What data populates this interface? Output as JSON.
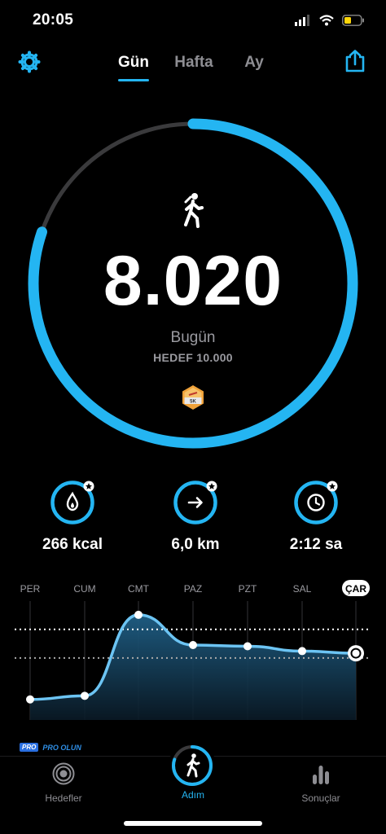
{
  "status": {
    "time": "20:05"
  },
  "tabs": [
    {
      "label": "Gün",
      "active": true
    },
    {
      "label": "Hafta",
      "active": false
    },
    {
      "label": "Ay",
      "active": false
    }
  ],
  "ring": {
    "steps": "8.020",
    "day_label": "Bugün",
    "goal_label": "HEDEF 10.000",
    "progress": 0.802,
    "badge_text": "5K"
  },
  "stats": [
    {
      "value": "266 kcal",
      "icon": "flame-icon"
    },
    {
      "value": "6,0 km",
      "icon": "arrow-right-icon"
    },
    {
      "value": "2:12 sa",
      "icon": "clock-icon"
    }
  ],
  "chart_data": {
    "type": "area",
    "categories": [
      "PER",
      "CUM",
      "CMT",
      "PAZ",
      "PZT",
      "SAL",
      "ÇAR"
    ],
    "values": [
      4200,
      4500,
      11200,
      8700,
      8600,
      8200,
      8020
    ],
    "goal_line": 10000,
    "current_index": 6
  },
  "pro": {
    "tag": "PRO",
    "text": "PRO OLUN"
  },
  "nav": [
    {
      "label": "Hedefler",
      "icon": "target-icon"
    },
    {
      "label": "Adım",
      "icon": "walk-icon",
      "active": true
    },
    {
      "label": "Sonuçlar",
      "icon": "bar-chart-icon"
    }
  ],
  "colors": {
    "accent": "#24b5f2",
    "track": "#3a3a3c"
  }
}
